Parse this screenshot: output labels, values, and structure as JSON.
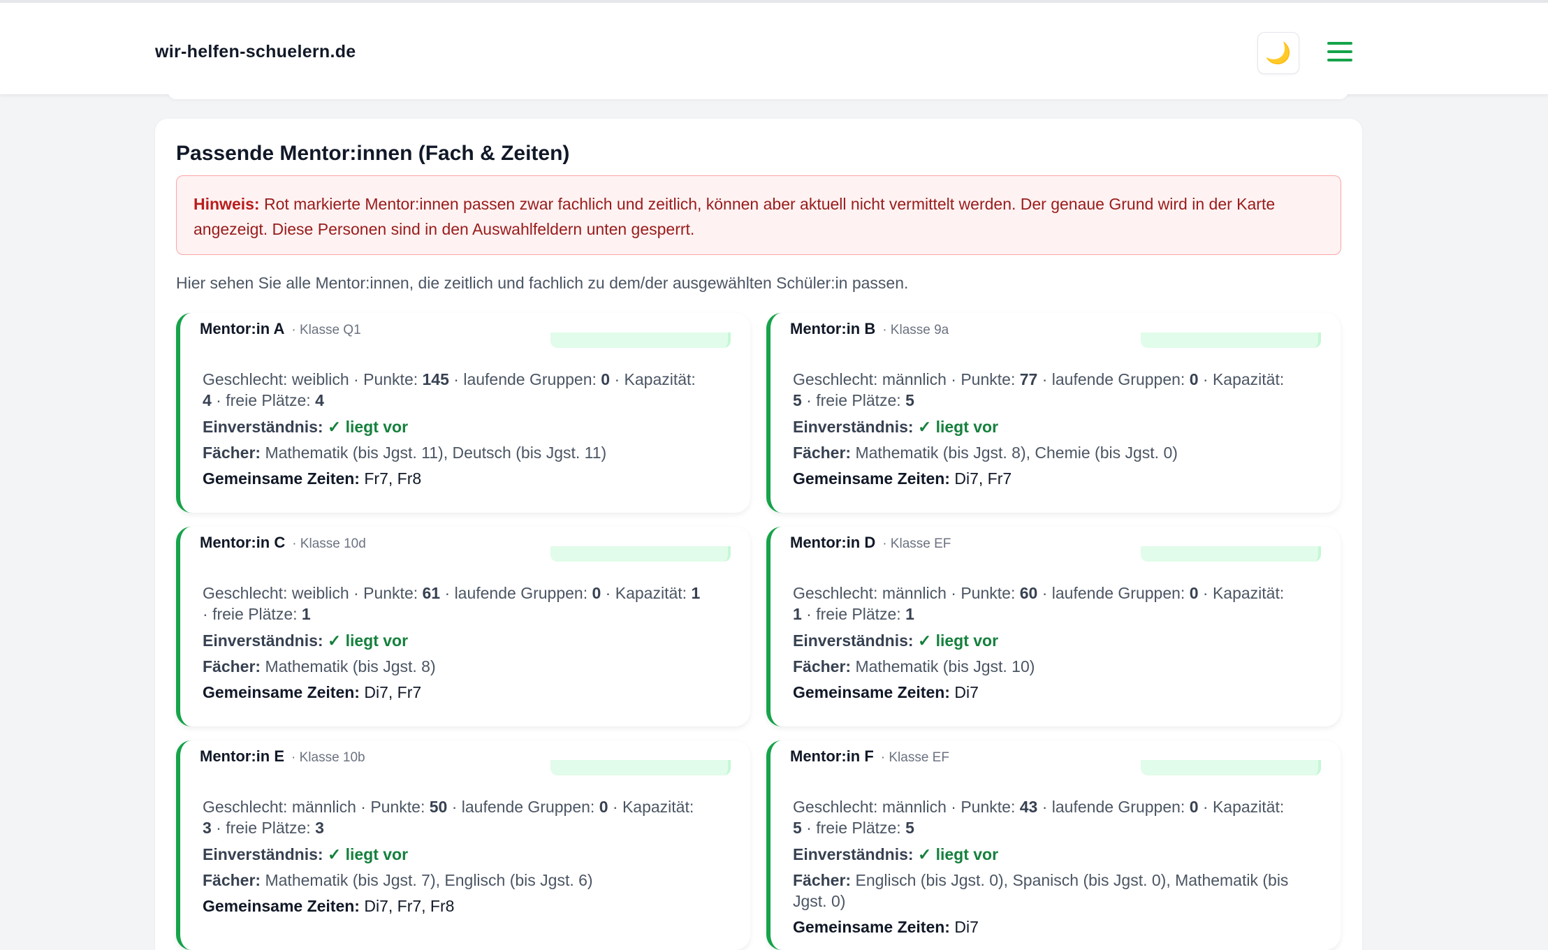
{
  "header": {
    "brand": "wir-helfen-schuelern.de",
    "theme_icon": "🌙",
    "accent_color": "#16a34a"
  },
  "section": {
    "title": "Passende Mentor:innen (Fach & Zeiten)",
    "hint_label": "Hinweis:",
    "hint_text": "Rot markierte Mentor:innen passen zwar fachlich und zeitlich, können aber aktuell nicht vermittelt werden. Der genaue Grund wird in der Karte angezeigt. Diese Personen sind in den Auswahlfeldern unten gesperrt.",
    "intro": "Hier sehen Sie alle Mentor:innen, die zeitlich und fachlich zu dem/der ausgewählten Schüler:in passen."
  },
  "labels": {
    "gender": "Geschlecht:",
    "points": "Punkte:",
    "groups": "laufende Gruppen:",
    "capacity": "Kapazität:",
    "free": "freie Plätze:",
    "consent": "Einverständnis:",
    "consent_value": "✓ liegt vor",
    "subjects": "Fächer:",
    "times": "Gemeinsame Zeiten:",
    "sep": " · "
  },
  "mentors": [
    {
      "name": "Mentor:in A",
      "klasse": "· Klasse Q1",
      "gender": "weiblich",
      "points": "145",
      "groups": "0",
      "capacity": "4",
      "free": "4",
      "subjects": "Mathematik (bis Jgst. 11), Deutsch (bis Jgst. 11)",
      "times": "Fr7, Fr8"
    },
    {
      "name": "Mentor:in B",
      "klasse": "· Klasse 9a",
      "gender": "männlich",
      "points": "77",
      "groups": "0",
      "capacity": "5",
      "free": "5",
      "subjects": "Mathematik (bis Jgst. 8), Chemie (bis Jgst. 0)",
      "times": "Di7, Fr7"
    },
    {
      "name": "Mentor:in C",
      "klasse": "· Klasse 10d",
      "gender": "weiblich",
      "points": "61",
      "groups": "0",
      "capacity": "1",
      "free": "1",
      "subjects": "Mathematik (bis Jgst. 8)",
      "times": "Di7, Fr7"
    },
    {
      "name": "Mentor:in D",
      "klasse": "· Klasse EF",
      "gender": "männlich",
      "points": "60",
      "groups": "0",
      "capacity": "1",
      "free": "1",
      "subjects": "Mathematik (bis Jgst. 10)",
      "times": "Di7"
    },
    {
      "name": "Mentor:in E",
      "klasse": "· Klasse 10b",
      "gender": "männlich",
      "points": "50",
      "groups": "0",
      "capacity": "3",
      "free": "3",
      "subjects": "Mathematik (bis Jgst. 7), Englisch (bis Jgst. 6)",
      "times": "Di7, Fr7, Fr8"
    },
    {
      "name": "Mentor:in F",
      "klasse": "· Klasse EF",
      "gender": "männlich",
      "points": "43",
      "groups": "0",
      "capacity": "5",
      "free": "5",
      "subjects": "Englisch (bis Jgst. 0), Spanisch (bis Jgst. 0), Mathematik (bis Jgst. 0)",
      "times": "Di7"
    }
  ]
}
